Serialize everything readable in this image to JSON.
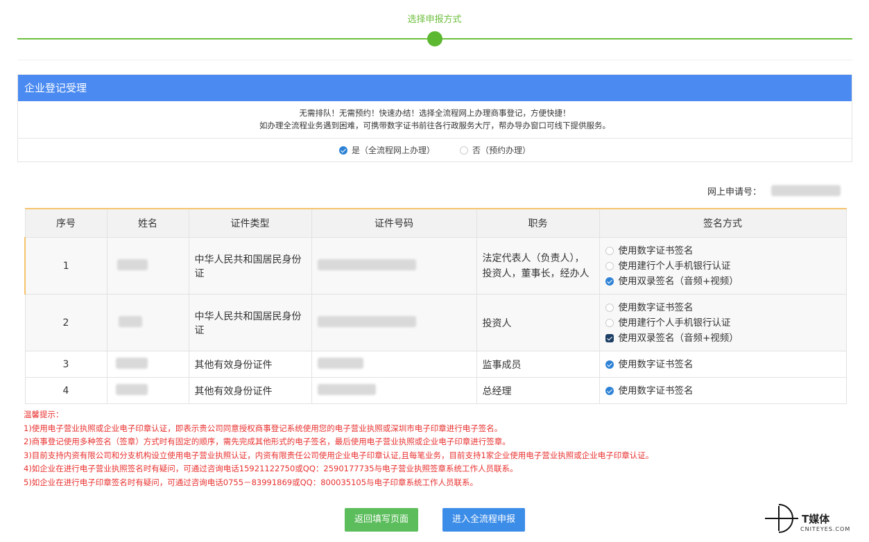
{
  "step": {
    "title": "选择申报方式"
  },
  "panel": {
    "title": "企业登记受理",
    "info_line1": "无需排队！无需预约！快速办结！选择全流程网上办理商事登记，方便快捷！",
    "info_line2": "如办理全流程业务遇到困难，可携带数字证书前往各行政服务大厅，帮办导办窗口可线下提供服务。",
    "options": [
      {
        "label": "是（全流程网上办理）",
        "selected": true
      },
      {
        "label": "否（预约办理）",
        "selected": false
      }
    ]
  },
  "apply_no_label": "网上申请号：",
  "table": {
    "headers": [
      "序号",
      "姓名",
      "证件类型",
      "证件号码",
      "职务",
      "签名方式"
    ],
    "rows": [
      {
        "no": "1",
        "id_type": "中华人民共和国居民身份证",
        "position": "法定代表人（负责人），投资人，董事长，经办人",
        "sign": [
          {
            "label": "使用数字证书签名",
            "checked": false
          },
          {
            "label": "使用建行个人手机银行认证",
            "checked": false
          },
          {
            "label": "使用双录签名（音频+视频）",
            "checked": true
          }
        ]
      },
      {
        "no": "2",
        "id_type": "中华人民共和国居民身份证",
        "position": "投资人",
        "sign": [
          {
            "label": "使用数字证书签名",
            "checked": false
          },
          {
            "label": "使用建行个人手机银行认证",
            "checked": false
          },
          {
            "label": "使用双录签名（音频+视频）",
            "checked": true
          }
        ]
      },
      {
        "no": "3",
        "id_type": "其他有效身份证件",
        "position": "监事成员",
        "sign": [
          {
            "label": "使用数字证书签名",
            "checked": true
          }
        ]
      },
      {
        "no": "4",
        "id_type": "其他有效身份证件",
        "position": "总经理",
        "sign": [
          {
            "label": "使用数字证书签名",
            "checked": true
          }
        ]
      }
    ]
  },
  "tips": {
    "title": "温馨提示：",
    "lines": [
      "1)使用电子营业执照或企业电子印章认证，即表示贵公司同意授权商事登记系统使用您的电子营业执照或深圳市电子印章进行电子签名。",
      "2)商事登记使用多种签名（签章）方式时有固定的顺序，需先完成其他形式的电子签名，最后使用电子营业执照或企业电子印章进行签章。",
      "3)目前支持内资有限公司和分支机构设立使用电子营业执照认证，内资有限责任公司使用企业电子印章认证,且每笔业务，目前支持1家企业使用电子营业执照或企业电子印章认证。",
      "4)如企业在进行电子营业执照签名时有疑问，可通过咨询电话15921122750或QQ：2590177735与电子营业执照签章系统工作人员联系。",
      "5)如企业在进行电子印章签名时有疑问，可通过咨询电话0755－83991869或QQ：800035105与电子印章系统工作人员联系。"
    ]
  },
  "buttons": {
    "back": "返回填写页面",
    "submit": "进入全流程申报"
  },
  "logo": {
    "text": "T媒体",
    "sub": "CNITEYES.COM"
  }
}
